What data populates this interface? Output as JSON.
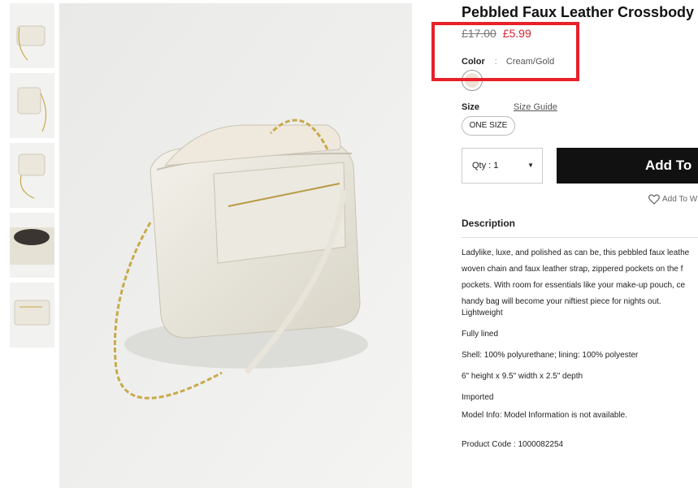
{
  "product": {
    "title": "Pebbled Faux Leather Crossbody",
    "price_old": "£17.00",
    "price_new": "£5.99",
    "color_label": "Color",
    "color_sep": ":",
    "color_value": "Cream/Gold",
    "swatch_color": "#efe1d6",
    "size_label": "Size",
    "size_guide": "Size Guide",
    "size_option": "ONE SIZE",
    "qty_label": "Qty : 1",
    "add_label": "Add To",
    "wishlist_label": "Add To W"
  },
  "description": {
    "heading": "Description",
    "paragraph": [
      "Ladylike, luxe, and polished as can be, this pebbled faux leathe",
      "woven chain and faux leather strap, zippered pockets on the f",
      "pockets. With room for essentials like your make-up pouch, ce",
      "handy bag will become your niftiest piece for nights out."
    ],
    "details": [
      "Lightweight",
      "Fully lined",
      "Shell: 100% polyurethane; lining: 100% polyester",
      "6\" height x 9.5\" width x 2.5\" depth",
      "Imported",
      "Model Info: Model Information is not available."
    ],
    "product_code": "Product Code : 1000082254"
  },
  "colors": {
    "accent_red": "#e8202a",
    "sale_red": "#d6232f",
    "button_black": "#111111"
  }
}
